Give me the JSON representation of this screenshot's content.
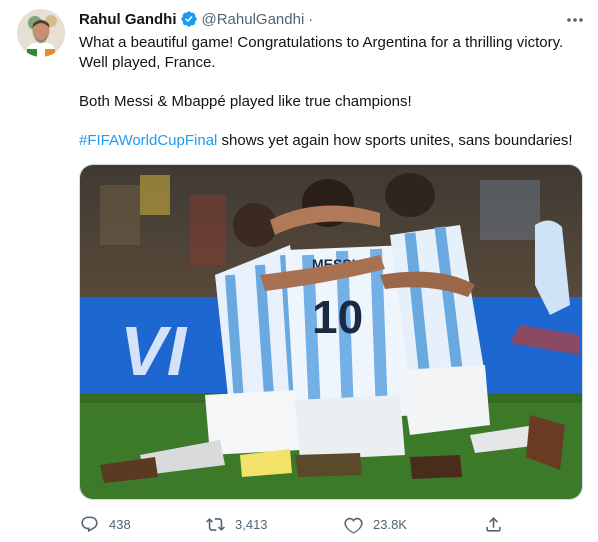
{
  "tweet": {
    "author": {
      "name": "Rahul Gandhi",
      "handle": "@RahulGandhi",
      "separator": "·"
    },
    "text": {
      "line1": "What a beautiful game! Congratulations to Argentina for a thrilling victory.",
      "line2": "Well played, France.",
      "line3": "Both Messi & Mbappé played like true champions!",
      "hashtag": "#FIFAWorldCupFinal",
      "line4_rest": " shows yet again how sports unites, sans boundaries!"
    },
    "media": {
      "jersey_name": "MESSI",
      "jersey_number": "10",
      "board_text": "VI"
    },
    "actions": {
      "replies": "438",
      "retweets": "3,413",
      "likes": "23.8K"
    }
  },
  "colors": {
    "link": "#1d9bf0",
    "verified": "#1d9bf0",
    "secondary_text": "#536471",
    "primary_text": "#0f1419",
    "board_blue": "#1e66d0",
    "pitch_green": "#3c7a2a"
  },
  "icons": [
    "verified-badge-icon",
    "more-options-icon",
    "reply-icon",
    "retweet-icon",
    "like-icon",
    "share-icon"
  ]
}
